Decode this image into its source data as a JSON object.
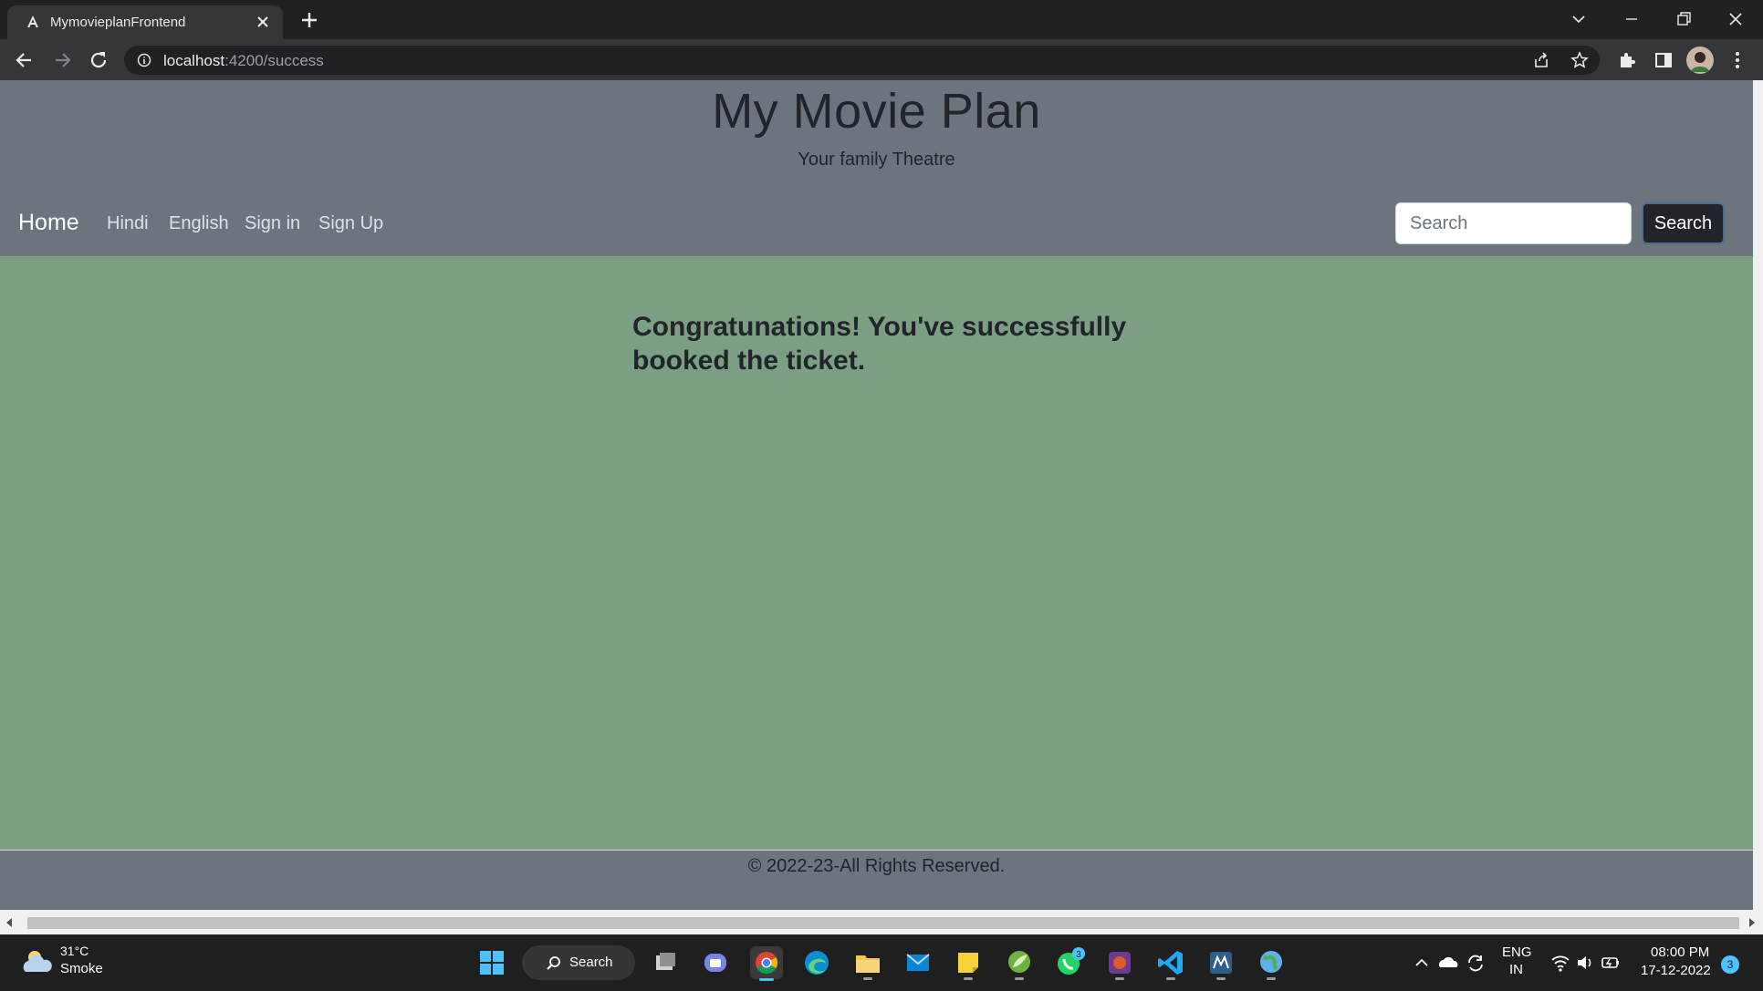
{
  "browser": {
    "tab_title": "MymovieplanFrontend",
    "url_host": "localhost",
    "url_path": ":4200/success"
  },
  "site": {
    "title": "My Movie Plan",
    "subtitle": "Your family Theatre",
    "nav": {
      "home": "Home",
      "links": [
        "Hindi",
        "English",
        "Sign in",
        "Sign Up"
      ]
    },
    "search": {
      "placeholder": "Search",
      "value": "",
      "button_label": "Search"
    },
    "message": "Congratunations! You've successfully booked the ticket.",
    "footer": "© 2022-23-All Rights Reserved."
  },
  "taskbar": {
    "weather_temp": "31°C",
    "weather_desc": "Smoke",
    "search_label": "Search",
    "whatsapp_badge": "3",
    "language": "ENG",
    "region": "IN",
    "time": "08:00 PM",
    "date": "17-12-2022",
    "notification_count": "3"
  },
  "colors": {
    "page_bg": "#7c9f84",
    "header_bg": "#6c757d",
    "search_button_bg": "#212529"
  }
}
